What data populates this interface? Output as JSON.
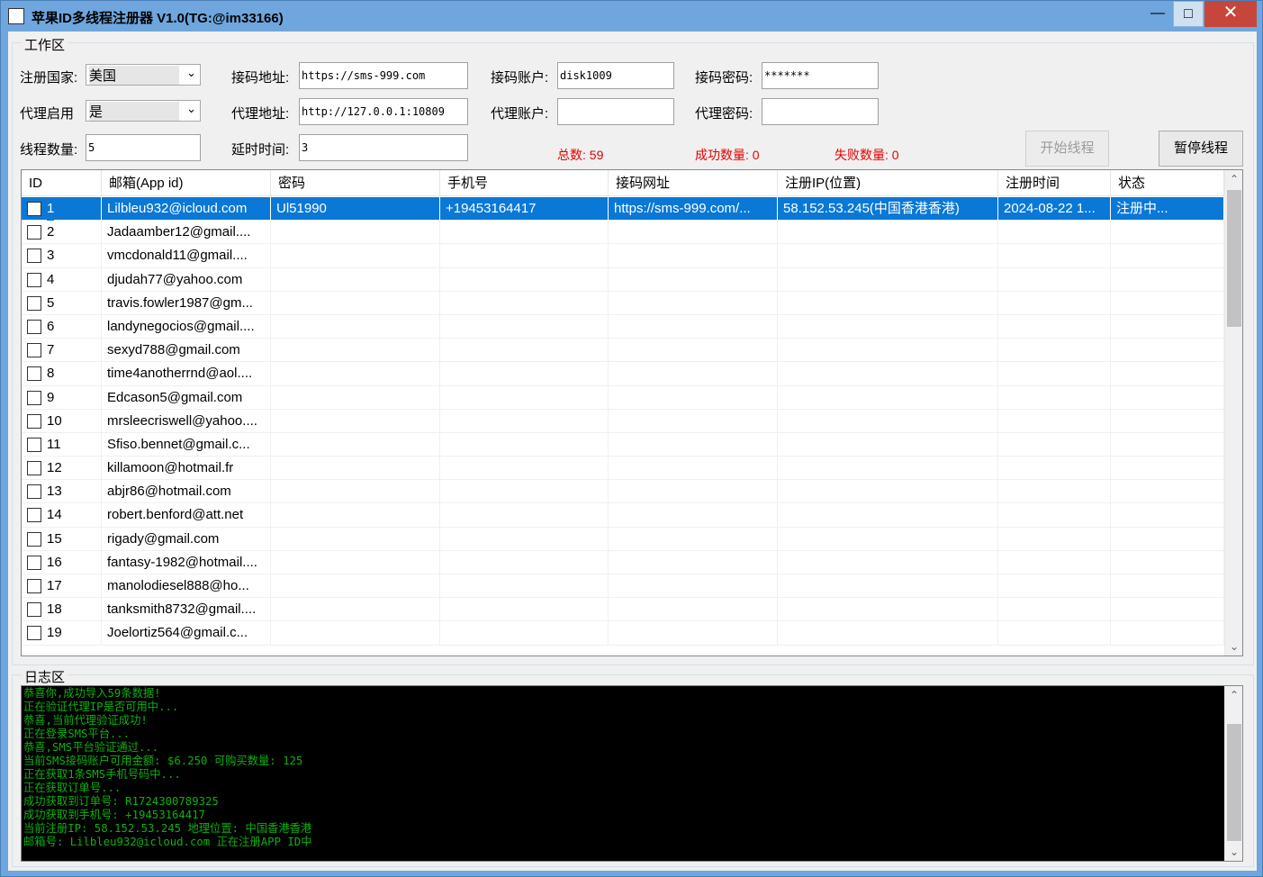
{
  "window": {
    "title": "苹果ID多线程注册器 V1.0(TG:@im33166)",
    "min_icon": "minimize-icon",
    "max_icon": "maximize-icon",
    "close_icon": "close-icon"
  },
  "work_area": {
    "title": "工作区",
    "country_label": "注册国家:",
    "country_value": "美国",
    "proxy_enable_label": "代理启用",
    "proxy_enable_value": "是",
    "thread_count_label": "线程数量:",
    "thread_count_value": "5",
    "sms_url_label": "接码地址:",
    "sms_url_value": "https://sms-999.com",
    "proxy_addr_label": "代理地址:",
    "proxy_addr_value": "http://127.0.0.1:10809",
    "delay_label": "延时时间:",
    "delay_value": "3",
    "sms_account_label": "接码账户:",
    "sms_account_value": "disk1009",
    "proxy_account_label": "代理账户:",
    "proxy_account_value": "",
    "sms_password_label": "接码密码:",
    "sms_password_value": "*******",
    "proxy_password_label": "代理密码:",
    "proxy_password_value": "",
    "total_label": "总数: 59",
    "success_label": "成功数量: 0",
    "fail_label": "失败数量: 0",
    "start_button": "开始线程",
    "pause_button": "暂停线程"
  },
  "table": {
    "columns": [
      "ID",
      "邮箱(App id)",
      "密码",
      "手机号",
      "接码网址",
      "注册IP(位置)",
      "注册时间",
      "状态"
    ],
    "rows": [
      {
        "id": "1",
        "email": "Lilbleu932@icloud.com",
        "password": "Ul51990",
        "phone": "+19453164417",
        "sms_url": "https://sms-999.com/...",
        "ip": "58.152.53.245(中国香港香港)",
        "time": "2024-08-22 1...",
        "status": "注册中..."
      },
      {
        "id": "2",
        "email": "Jadaamber12@gmail....",
        "password": "",
        "phone": "",
        "sms_url": "",
        "ip": "",
        "time": "",
        "status": ""
      },
      {
        "id": "3",
        "email": "vmcdonald11@gmail....",
        "password": "",
        "phone": "",
        "sms_url": "",
        "ip": "",
        "time": "",
        "status": ""
      },
      {
        "id": "4",
        "email": "djudah77@yahoo.com",
        "password": "",
        "phone": "",
        "sms_url": "",
        "ip": "",
        "time": "",
        "status": ""
      },
      {
        "id": "5",
        "email": "travis.fowler1987@gm...",
        "password": "",
        "phone": "",
        "sms_url": "",
        "ip": "",
        "time": "",
        "status": ""
      },
      {
        "id": "6",
        "email": "landynegocios@gmail....",
        "password": "",
        "phone": "",
        "sms_url": "",
        "ip": "",
        "time": "",
        "status": ""
      },
      {
        "id": "7",
        "email": "sexyd788@gmail.com",
        "password": "",
        "phone": "",
        "sms_url": "",
        "ip": "",
        "time": "",
        "status": ""
      },
      {
        "id": "8",
        "email": "time4anotherrnd@aol....",
        "password": "",
        "phone": "",
        "sms_url": "",
        "ip": "",
        "time": "",
        "status": ""
      },
      {
        "id": "9",
        "email": "Edcason5@gmail.com",
        "password": "",
        "phone": "",
        "sms_url": "",
        "ip": "",
        "time": "",
        "status": ""
      },
      {
        "id": "10",
        "email": "mrsleecriswell@yahoo....",
        "password": "",
        "phone": "",
        "sms_url": "",
        "ip": "",
        "time": "",
        "status": ""
      },
      {
        "id": "11",
        "email": "Sfiso.bennet@gmail.c...",
        "password": "",
        "phone": "",
        "sms_url": "",
        "ip": "",
        "time": "",
        "status": ""
      },
      {
        "id": "12",
        "email": "killamoon@hotmail.fr",
        "password": "",
        "phone": "",
        "sms_url": "",
        "ip": "",
        "time": "",
        "status": ""
      },
      {
        "id": "13",
        "email": "abjr86@hotmail.com",
        "password": "",
        "phone": "",
        "sms_url": "",
        "ip": "",
        "time": "",
        "status": ""
      },
      {
        "id": "14",
        "email": "robert.benford@att.net",
        "password": "",
        "phone": "",
        "sms_url": "",
        "ip": "",
        "time": "",
        "status": ""
      },
      {
        "id": "15",
        "email": "rigady@gmail.com",
        "password": "",
        "phone": "",
        "sms_url": "",
        "ip": "",
        "time": "",
        "status": ""
      },
      {
        "id": "16",
        "email": "fantasy-1982@hotmail....",
        "password": "",
        "phone": "",
        "sms_url": "",
        "ip": "",
        "time": "",
        "status": ""
      },
      {
        "id": "17",
        "email": "manolodiesel888@ho...",
        "password": "",
        "phone": "",
        "sms_url": "",
        "ip": "",
        "time": "",
        "status": ""
      },
      {
        "id": "18",
        "email": "tanksmith8732@gmail....",
        "password": "",
        "phone": "",
        "sms_url": "",
        "ip": "",
        "time": "",
        "status": ""
      },
      {
        "id": "19",
        "email": "Joelortiz564@gmail.c...",
        "password": "",
        "phone": "",
        "sms_url": "",
        "ip": "",
        "time": "",
        "status": ""
      }
    ]
  },
  "log_area": {
    "title": "日志区",
    "lines": [
      "恭喜你,成功导入59条数据!",
      "正在验证代理IP是否可用中...",
      "恭喜,当前代理验证成功!",
      "正在登录SMS平台...",
      "恭喜,SMS平台验证通过...",
      "当前SMS接码账户可用金额: $6.250 可购买数量: 125",
      "正在获取1条SMS手机号码中...",
      "正在获取订单号...",
      "成功获取到订单号: R1724300789325",
      "成功获取到手机号: +19453164417",
      "当前注册IP: 58.152.53.245 地理位置: 中国香港香港",
      "邮箱号: Lilbleu932@icloud.com 正在注册APP ID中"
    ]
  }
}
